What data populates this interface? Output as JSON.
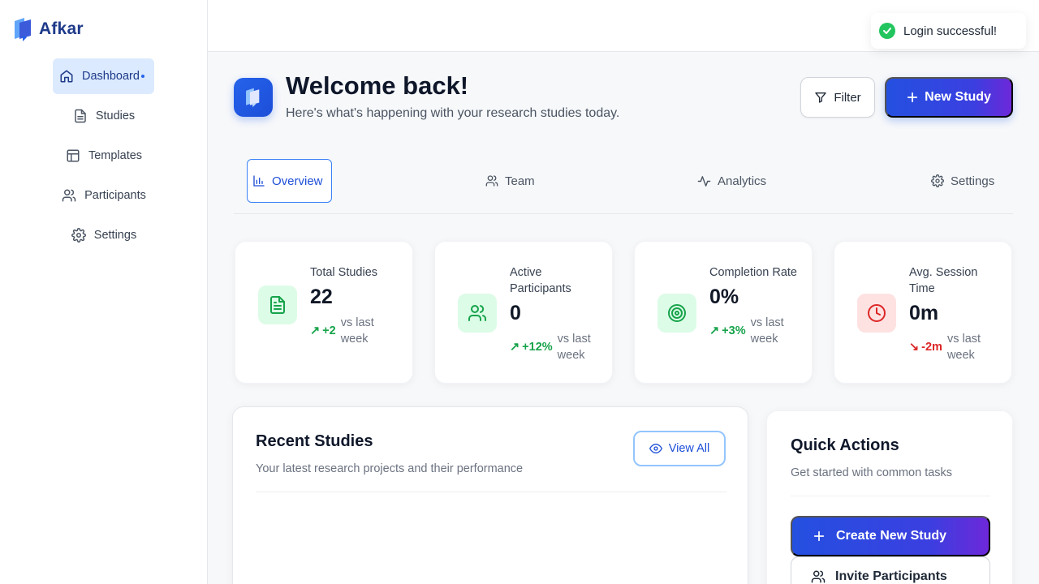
{
  "brand": {
    "name": "Afkar",
    "accent": "#2563eb"
  },
  "sidebar": {
    "items": [
      {
        "label": "Dashboard",
        "icon": "home-icon",
        "active": true
      },
      {
        "label": "Studies",
        "icon": "document-icon"
      },
      {
        "label": "Templates",
        "icon": "layout-icon"
      },
      {
        "label": "Participants",
        "icon": "users-icon"
      },
      {
        "label": "Settings",
        "icon": "gear-icon"
      }
    ]
  },
  "toast": {
    "message": "Login successful!",
    "icon": "check-circle-icon",
    "color": "#22c55e"
  },
  "header": {
    "title": "Welcome back!",
    "subtitle": "Here's what's happening with your research studies today.",
    "filter_label": "Filter",
    "new_study_label": "New Study"
  },
  "tabs": [
    {
      "label": "Overview",
      "icon": "bar-chart-icon",
      "active": true
    },
    {
      "label": "Team",
      "icon": "users-icon"
    },
    {
      "label": "Analytics",
      "icon": "activity-icon"
    },
    {
      "label": "Settings",
      "icon": "gear-icon"
    }
  ],
  "stats": [
    {
      "label": "Total Studies",
      "value": "22",
      "delta": "+2",
      "trend": "up",
      "vs": "vs last week",
      "icon": "document-icon",
      "color": "#16a34a"
    },
    {
      "label": "Active Participants",
      "value": "0",
      "delta": "+12%",
      "trend": "up",
      "vs": "vs last week",
      "icon": "users-icon",
      "color": "#16a34a"
    },
    {
      "label": "Completion Rate",
      "value": "0%",
      "delta": "+3%",
      "trend": "up",
      "vs": "vs last week",
      "icon": "target-icon",
      "color": "#16a34a"
    },
    {
      "label": "Avg. Session Time",
      "value": "0m",
      "delta": "-2m",
      "trend": "down",
      "vs": "vs last week",
      "icon": "clock-icon",
      "color": "#dc2626"
    }
  ],
  "recent": {
    "title": "Recent Studies",
    "subtitle": "Your latest research projects and their performance",
    "view_all_label": "View All"
  },
  "quick": {
    "title": "Quick Actions",
    "subtitle": "Get started with common tasks",
    "create_label": "Create New Study",
    "invite_label": "Invite Participants"
  }
}
